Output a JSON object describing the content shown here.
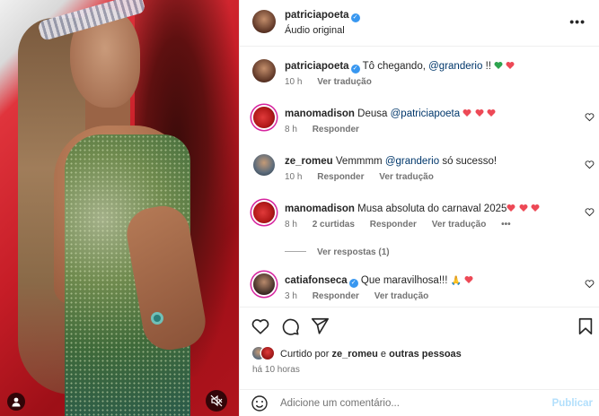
{
  "post": {
    "author": "patriciapoeta",
    "audio_label": "Áudio original",
    "caption_author": "patriciapoeta",
    "caption_text": "Tô chegando,",
    "caption_mention": "@granderio",
    "caption_suffix": "!!",
    "caption_time": "10 h",
    "caption_translate": "Ver tradução"
  },
  "comments": [
    {
      "user": "manomadison",
      "text_before": "Deusa",
      "mention": "@patriciapoeta",
      "text_after": "",
      "time": "8 h",
      "likes": "",
      "reply": "Responder",
      "translate": ""
    },
    {
      "user": "ze_romeu",
      "text_before": "Vemmmm",
      "mention": "@granderio",
      "text_after": "só sucesso!",
      "time": "10 h",
      "likes": "",
      "reply": "Responder",
      "translate": "Ver tradução"
    },
    {
      "user": "manomadison",
      "text_before": "Musa absoluta do carnaval 2025",
      "mention": "",
      "text_after": "",
      "time": "8 h",
      "likes": "2 curtidas",
      "reply": "Responder",
      "translate": "Ver tradução",
      "more": "•••"
    },
    {
      "user": "catiafonseca",
      "text_before": "Que maravilhosa!!!",
      "mention": "",
      "text_after": "",
      "time": "3 h",
      "likes": "",
      "reply": "Responder",
      "translate": "Ver tradução"
    }
  ],
  "view_replies": "Ver respostas (1)",
  "liked_by": {
    "prefix": "Curtido por",
    "user": "ze_romeu",
    "conj": "e",
    "others": "outras pessoas"
  },
  "time_ago": "há 10 horas",
  "add_comment": {
    "placeholder": "Adicione um comentário...",
    "publish": "Publicar"
  },
  "colors": {
    "verified": "#3897f0",
    "heart_red": "#ed4956",
    "green_heart": "#2ea44f",
    "mention": "#00376b",
    "publish_disabled": "#b2dffc"
  },
  "icons": [
    "more-icon",
    "heart-icon",
    "comment-icon",
    "share-icon",
    "save-icon",
    "emoji-icon",
    "user-tag-icon",
    "mute-icon"
  ]
}
